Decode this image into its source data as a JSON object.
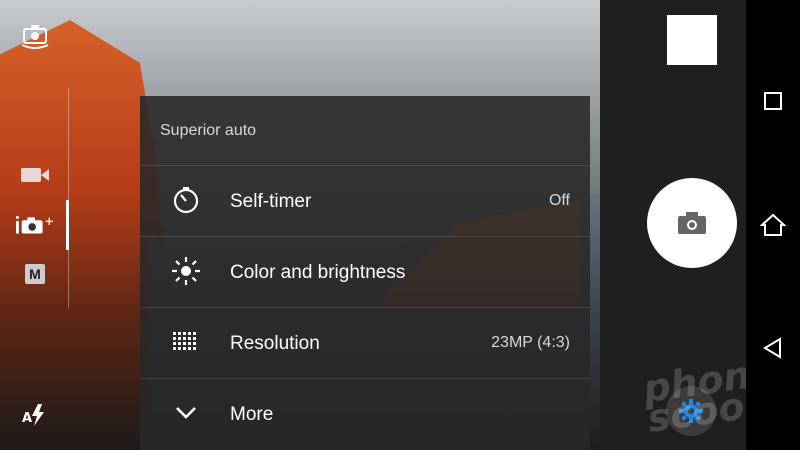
{
  "menu": {
    "title": "Superior auto",
    "items": [
      {
        "icon": "self-timer-icon",
        "label": "Self-timer",
        "value": "Off"
      },
      {
        "icon": "brightness-icon",
        "label": "Color and brightness",
        "value": ""
      },
      {
        "icon": "resolution-grid-icon",
        "label": "Resolution",
        "value": "23MP (4:3)"
      },
      {
        "icon": "chevron-down-icon",
        "label": "More",
        "value": ""
      }
    ]
  },
  "left_rail": {
    "icons": [
      "switch-camera-icon",
      "video-camera-icon",
      "superior-auto-camera-icon",
      "manual-mode-icon",
      "auto-flash-icon"
    ],
    "manual_mode_label": "M",
    "active_mode": "superior-auto-camera-icon"
  },
  "right_panel": {
    "icons": [
      "last-photo-thumbnail",
      "shutter-camera-icon",
      "settings-gear-icon"
    ],
    "watermark": "phone\nscoop"
  },
  "nav_bar": {
    "icons": [
      "recents-square-icon",
      "home-icon",
      "back-icon"
    ]
  },
  "colors": {
    "menu_bg": "#282828",
    "accent_blue": "#1e88e5",
    "panel_bg": "#1f1f1f"
  }
}
